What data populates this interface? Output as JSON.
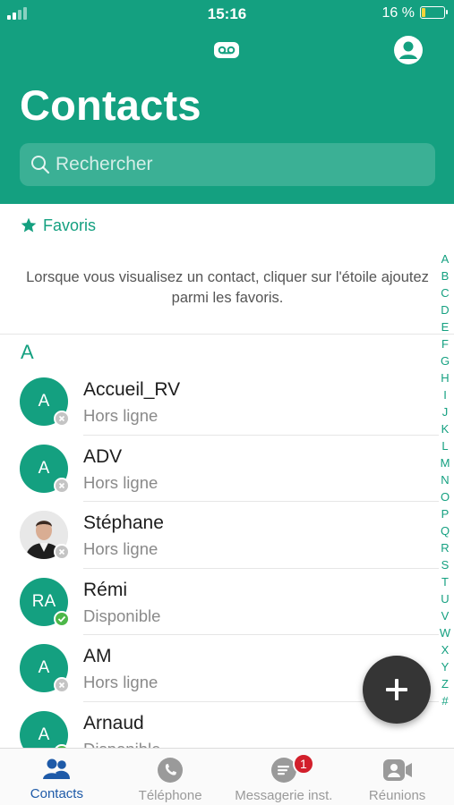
{
  "status_bar": {
    "time": "15:16",
    "battery": "16 %",
    "battery_level": 0.16
  },
  "header": {
    "title": "Contacts",
    "icons": [
      "voicemail-icon",
      "profile-icon"
    ]
  },
  "search": {
    "placeholder": "Rechercher"
  },
  "favorites": {
    "label": "Favoris",
    "message": "Lorsque vous visualisez un contact, cliquer sur l'étoile ajoutez parmi les favoris."
  },
  "section": {
    "letter": "A"
  },
  "contacts": [
    {
      "initials": "A",
      "name": "Accueil_RV",
      "status": "Hors ligne",
      "presence": "offline"
    },
    {
      "initials": "A",
      "name": "ADV",
      "status": "Hors ligne",
      "presence": "offline"
    },
    {
      "initials": "",
      "name": "Stéphane",
      "status": "Hors ligne",
      "presence": "offline",
      "photo": true
    },
    {
      "initials": "RA",
      "name": "Rémi",
      "status": "Disponible",
      "presence": "online"
    },
    {
      "initials": "A",
      "name": "AM",
      "status": "Hors ligne",
      "presence": "offline"
    },
    {
      "initials": "A",
      "name": "Arnaud",
      "status": "Disponible",
      "presence": "online"
    }
  ],
  "alphabet": [
    "A",
    "B",
    "C",
    "D",
    "E",
    "F",
    "G",
    "H",
    "I",
    "J",
    "K",
    "L",
    "M",
    "N",
    "O",
    "P",
    "Q",
    "R",
    "S",
    "T",
    "U",
    "V",
    "W",
    "X",
    "Y",
    "Z",
    "#"
  ],
  "tabs": [
    {
      "label": "Contacts",
      "icon": "contacts-icon",
      "active": true
    },
    {
      "label": "Téléphone",
      "icon": "phone-icon"
    },
    {
      "label": "Messagerie inst.",
      "icon": "chat-icon",
      "badge": "1"
    },
    {
      "label": "Réunions",
      "icon": "meeting-icon"
    }
  ],
  "colors": {
    "brand": "#14a080",
    "active_tab": "#1e5aa8",
    "badge": "#d21f2b",
    "online": "#4cb748",
    "offline": "#c4c4c4",
    "fab": "#353535"
  }
}
